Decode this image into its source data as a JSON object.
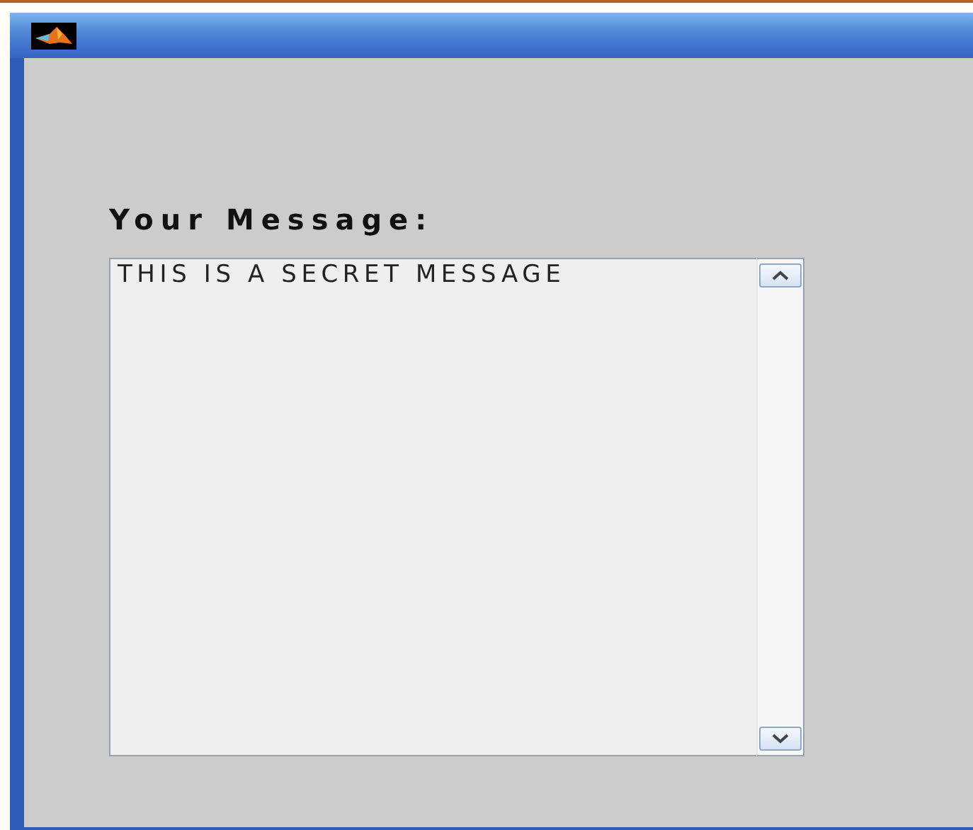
{
  "message_panel": {
    "label": "Your Message:",
    "text": "THIS IS A SECRET MESSAGE"
  }
}
